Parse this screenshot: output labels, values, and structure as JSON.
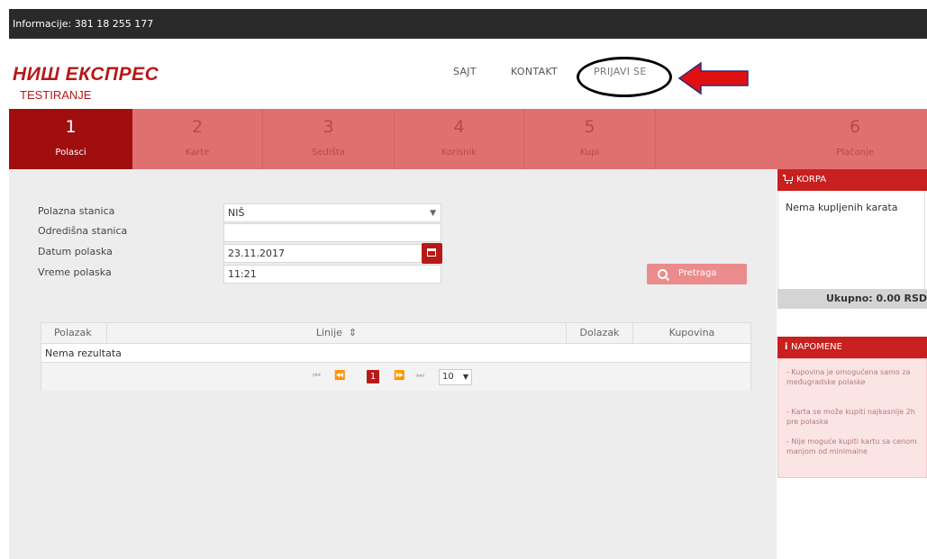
{
  "topbar": {
    "info": "Informacije: 381 18 255 177"
  },
  "brand": {
    "name": "НИШ ЕКСПРЕС",
    "subtitle": "TESTIRANJE"
  },
  "nav": {
    "sajt": "SAJT",
    "kontakt": "KONTAKT",
    "prijavi": "PRIJAVI SE"
  },
  "colors": {
    "brand_red": "#b81818",
    "step_active": "#a00e0e",
    "step_bg": "#e07070",
    "annotation_arrow": "#e01010"
  },
  "steps": [
    {
      "num": "1",
      "label": "Polasci"
    },
    {
      "num": "2",
      "label": "Karte"
    },
    {
      "num": "3",
      "label": "Sedišta"
    },
    {
      "num": "4",
      "label": "Korisnik"
    },
    {
      "num": "5",
      "label": "Kupi"
    },
    {
      "num": "6",
      "label": "Plaćanje"
    }
  ],
  "form": {
    "polazna_label": "Polazna stanica",
    "polazna_value": "NIŠ",
    "odredisna_label": "Odredišna stanica",
    "odredisna_value": "",
    "datum_label": "Datum polaska",
    "datum_value": "23.11.2017",
    "vreme_label": "Vreme polaska",
    "vreme_value": "11:21",
    "search_label": "Pretraga"
  },
  "table": {
    "headers": [
      "Polazak",
      "Linije",
      "Dolazak",
      "Kupovina"
    ],
    "empty": "Nema rezultata",
    "current_page": "1",
    "page_size": "10"
  },
  "cart": {
    "title": "KORPA",
    "empty": "Nema kupljenih karata",
    "total": "Ukupno: 0.00 RSD"
  },
  "notes": {
    "title": "NAPOMENE",
    "items": [
      "- Kupovina je omogućena samo za međugradske polaske",
      "- Karta se može kupiti najkasnije 2h pre polaska",
      "- Nije moguće kupiti kartu sa cenom manjom od minimalne"
    ]
  }
}
